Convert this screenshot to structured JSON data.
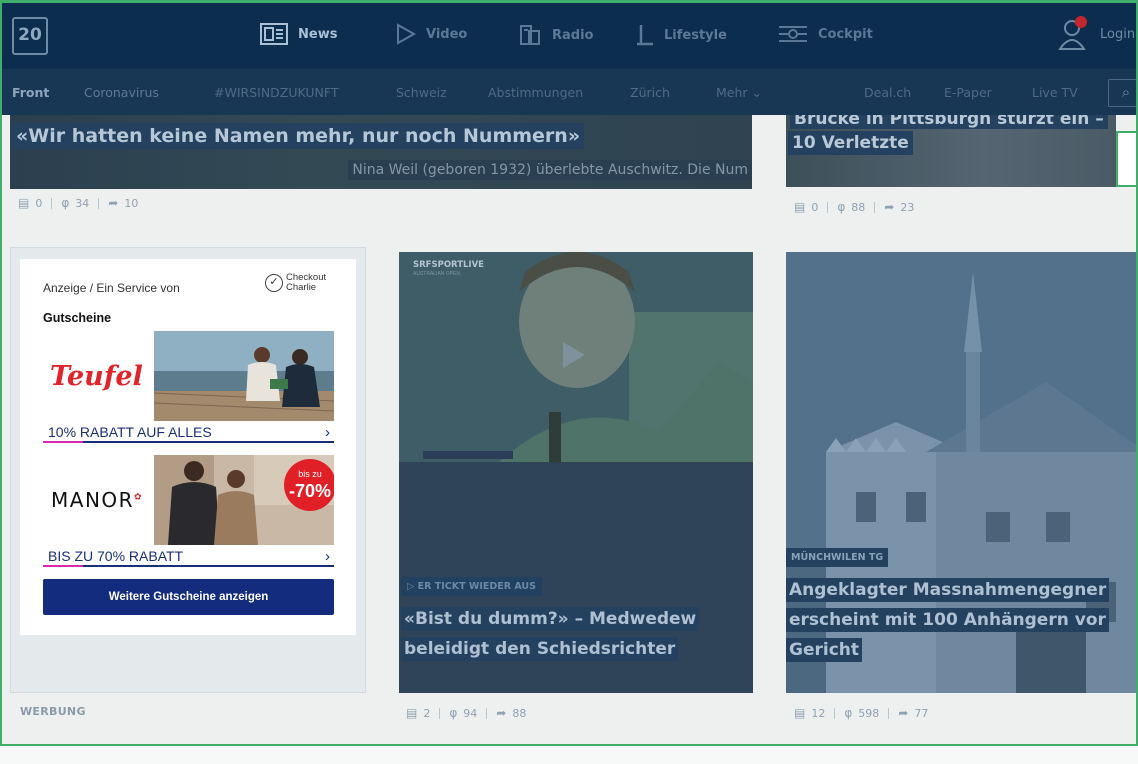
{
  "logo": {
    "text": "20"
  },
  "topnav": {
    "items": [
      {
        "label": "News",
        "icon": "news-icon"
      },
      {
        "label": "Video",
        "icon": "play-icon"
      },
      {
        "label": "Radio",
        "icon": "radio-icon"
      },
      {
        "label": "Lifestyle",
        "icon": "lifestyle-icon"
      },
      {
        "label": "Cockpit",
        "icon": "cockpit-icon"
      }
    ],
    "login": "Login"
  },
  "subnav": {
    "items": [
      "Front",
      "Coronavirus",
      "#WIRSINDZUKUNFT",
      "Schweiz",
      "Abstimmungen",
      "Zürich",
      "Mehr"
    ],
    "right": [
      "Deal.ch",
      "E-Paper",
      "Live TV"
    ]
  },
  "article1": {
    "title": "«Wir hatten keine Namen mehr, nur noch Nummern»",
    "subtitle": "Nina Weil (geboren 1932) überlebte Auschwitz. Die Num",
    "comments": "0",
    "likes": "34",
    "shares": "10"
  },
  "article2": {
    "title_cut": "Brücke in Pittsburgh stürzt ein –",
    "title": "10 Verletzte",
    "comments": "0",
    "likes": "88",
    "shares": "23"
  },
  "ad": {
    "header": "Anzeige / Ein Service von",
    "provider_line1": "Checkout",
    "provider_line2": "Charlie",
    "section": "Gutscheine",
    "offers": [
      {
        "brand": "Teufel",
        "label": "10% RABATT AUF ALLES"
      },
      {
        "brand": "MANOR",
        "label": "BIS ZU 70% RABATT",
        "badge_top": "bis zu",
        "badge_value": "-70%"
      }
    ],
    "button": "Weitere Gutscheine anzeigen",
    "footer": "WERBUNG"
  },
  "video_card": {
    "channel": "SRFSPORTLIVE",
    "channel_sub": "AUSTRALIAN OPEN",
    "kicker": "ER TICKT WIEDER AUS",
    "title": "«Bist du dumm?» – Medwedew beleidigt den Schiedsrichter",
    "comments": "2",
    "likes": "94",
    "shares": "88"
  },
  "church_card": {
    "kicker": "MÜNCHWILEN TG",
    "title": "Angeklagter Massnahmengegner erscheint mit 100 Anhängern vor Gericht",
    "comments": "12",
    "likes": "598",
    "shares": "77"
  },
  "colors": {
    "nav_bg": "#0d2d4e",
    "accent_red": "#e1242a",
    "button_blue": "#132c7e",
    "frame_green": "#3fae6a"
  }
}
